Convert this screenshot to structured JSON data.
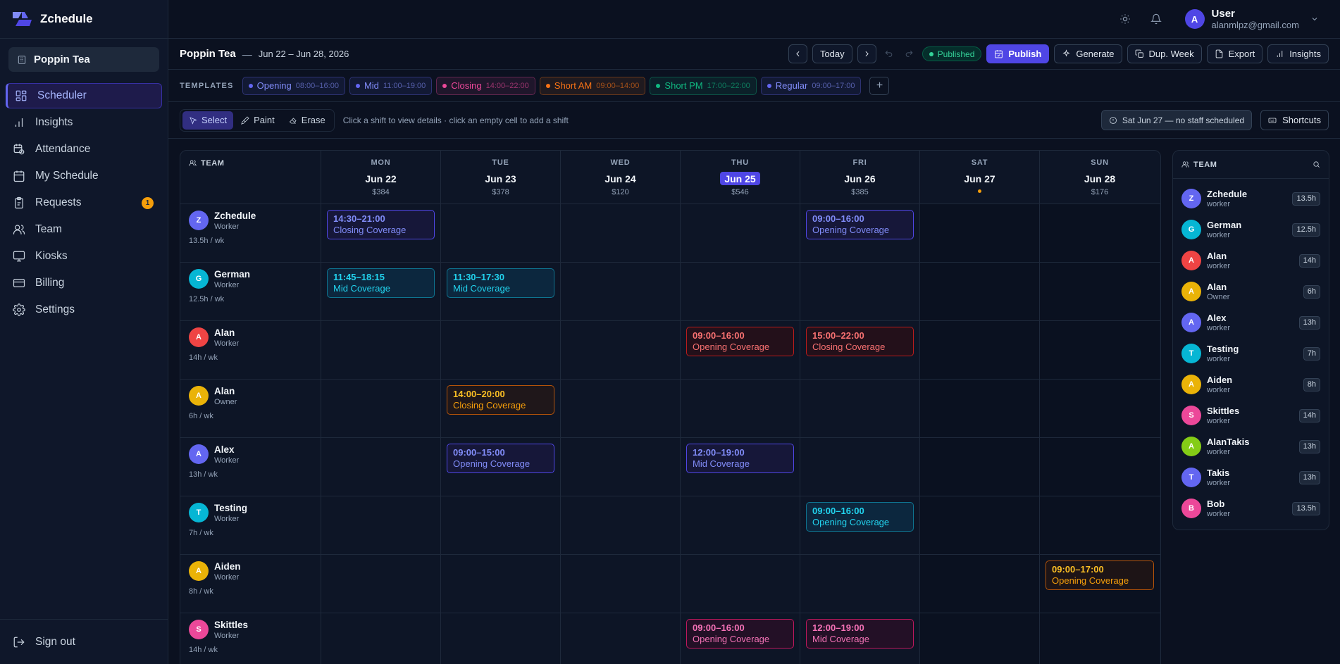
{
  "app": {
    "name": "Zchedule"
  },
  "sidebar": {
    "org": "Poppin Tea",
    "items": [
      {
        "label": "Scheduler",
        "icon": "grid-icon",
        "active": true
      },
      {
        "label": "Insights",
        "icon": "bar-chart-icon"
      },
      {
        "label": "Attendance",
        "icon": "clock-calendar-icon"
      },
      {
        "label": "My Schedule",
        "icon": "calendar-icon"
      },
      {
        "label": "Requests",
        "icon": "clipboard-icon",
        "badge": "1"
      },
      {
        "label": "Team",
        "icon": "users-icon"
      },
      {
        "label": "Kiosks",
        "icon": "monitor-icon"
      },
      {
        "label": "Billing",
        "icon": "credit-card-icon"
      },
      {
        "label": "Settings",
        "icon": "gear-icon"
      }
    ],
    "signout": "Sign out"
  },
  "topbar": {
    "user_initial": "A",
    "user_name": "User",
    "user_email": "alanmlpz@gmail.com"
  },
  "header": {
    "location": "Poppin Tea",
    "dash": "—",
    "range": "Jun 22 – Jun 28, 2026",
    "today": "Today",
    "status": "Published",
    "publish": "Publish",
    "generate": "Generate",
    "dup_week": "Dup. Week",
    "export": "Export",
    "insights": "Insights"
  },
  "templates": {
    "label": "TEMPLATES",
    "items": [
      {
        "name": "Opening",
        "time": "08:00–16:00",
        "color": "#6366f1"
      },
      {
        "name": "Mid",
        "time": "11:00–19:00",
        "color": "#6366f1"
      },
      {
        "name": "Closing",
        "time": "14:00–22:00",
        "color": "#ec4899"
      },
      {
        "name": "Short AM",
        "time": "09:00–14:00",
        "color": "#f97316"
      },
      {
        "name": "Short PM",
        "time": "17:00–22:00",
        "color": "#10b981"
      },
      {
        "name": "Regular",
        "time": "09:00–17:00",
        "color": "#6366f1"
      }
    ],
    "add": "+"
  },
  "tools": {
    "select": "Select",
    "paint": "Paint",
    "erase": "Erase",
    "hint": "Click a shift to view details · click an empty cell to add a shift",
    "warning": "Sat Jun 27 — no staff scheduled",
    "shortcuts": "Shortcuts"
  },
  "grid": {
    "team_label": "TEAM",
    "days": [
      {
        "dow": "MON",
        "date": "Jun 22",
        "cost": "$384"
      },
      {
        "dow": "TUE",
        "date": "Jun 23",
        "cost": "$378"
      },
      {
        "dow": "WED",
        "date": "Jun 24",
        "cost": "$120"
      },
      {
        "dow": "THU",
        "date": "Jun 25",
        "cost": "$546",
        "today": true
      },
      {
        "dow": "FRI",
        "date": "Jun 26",
        "cost": "$385"
      },
      {
        "dow": "SAT",
        "date": "Jun 27",
        "cost": "",
        "warning": true
      },
      {
        "dow": "SUN",
        "date": "Jun 28",
        "cost": "$176"
      }
    ],
    "rows": [
      {
        "name": "Zchedule",
        "role": "Worker",
        "hours": "13.5h / wk",
        "initial": "Z",
        "color": "#6366f1",
        "shifts": [
          {
            "day": 0,
            "time": "14:30–21:00",
            "label": "Closing Coverage",
            "theme": "indigo"
          },
          {
            "day": 4,
            "time": "09:00–16:00",
            "label": "Opening Coverage",
            "theme": "indigo"
          }
        ]
      },
      {
        "name": "German",
        "role": "Worker",
        "hours": "12.5h / wk",
        "initial": "G",
        "color": "#06b6d4",
        "shifts": [
          {
            "day": 0,
            "time": "11:45–18:15",
            "label": "Mid Coverage",
            "theme": "cyan"
          },
          {
            "day": 1,
            "time": "11:30–17:30",
            "label": "Mid Coverage",
            "theme": "cyan"
          }
        ]
      },
      {
        "name": "Alan",
        "role": "Worker",
        "hours": "14h / wk",
        "initial": "A",
        "color": "#ef4444",
        "shifts": [
          {
            "day": 3,
            "time": "09:00–16:00",
            "label": "Opening Coverage",
            "theme": "red"
          },
          {
            "day": 4,
            "time": "15:00–22:00",
            "label": "Closing Coverage",
            "theme": "red"
          }
        ]
      },
      {
        "name": "Alan",
        "role": "Owner",
        "hours": "6h / wk",
        "initial": "A",
        "color": "#eab308",
        "shifts": [
          {
            "day": 1,
            "time": "14:00–20:00",
            "label": "Closing Coverage",
            "theme": "amber"
          }
        ]
      },
      {
        "name": "Alex",
        "role": "Worker",
        "hours": "13h / wk",
        "initial": "A",
        "color": "#6366f1",
        "shifts": [
          {
            "day": 1,
            "time": "09:00–15:00",
            "label": "Opening Coverage",
            "theme": "indigo"
          },
          {
            "day": 3,
            "time": "12:00–19:00",
            "label": "Mid Coverage",
            "theme": "indigo"
          }
        ]
      },
      {
        "name": "Testing",
        "role": "Worker",
        "hours": "7h / wk",
        "initial": "T",
        "color": "#06b6d4",
        "shifts": [
          {
            "day": 4,
            "time": "09:00–16:00",
            "label": "Opening Coverage",
            "theme": "cyan"
          }
        ]
      },
      {
        "name": "Aiden",
        "role": "Worker",
        "hours": "8h / wk",
        "initial": "A",
        "color": "#eab308",
        "shifts": [
          {
            "day": 6,
            "time": "09:00–17:00",
            "label": "Opening Coverage",
            "theme": "amber"
          }
        ]
      },
      {
        "name": "Skittles",
        "role": "Worker",
        "hours": "14h / wk",
        "initial": "S",
        "color": "#ec4899",
        "shifts": [
          {
            "day": 3,
            "time": "09:00–16:00",
            "label": "Opening Coverage",
            "theme": "pink"
          },
          {
            "day": 4,
            "time": "12:00–19:00",
            "label": "Mid Coverage",
            "theme": "pink"
          }
        ]
      }
    ]
  },
  "team_panel": {
    "title": "TEAM",
    "members": [
      {
        "name": "Zchedule",
        "role": "worker",
        "hours": "13.5h",
        "initial": "Z",
        "color": "#6366f1"
      },
      {
        "name": "German",
        "role": "worker",
        "hours": "12.5h",
        "initial": "G",
        "color": "#06b6d4"
      },
      {
        "name": "Alan",
        "role": "worker",
        "hours": "14h",
        "initial": "A",
        "color": "#ef4444"
      },
      {
        "name": "Alan",
        "role": "Owner",
        "hours": "6h",
        "initial": "A",
        "color": "#eab308"
      },
      {
        "name": "Alex",
        "role": "worker",
        "hours": "13h",
        "initial": "A",
        "color": "#6366f1"
      },
      {
        "name": "Testing",
        "role": "worker",
        "hours": "7h",
        "initial": "T",
        "color": "#06b6d4"
      },
      {
        "name": "Aiden",
        "role": "worker",
        "hours": "8h",
        "initial": "A",
        "color": "#eab308"
      },
      {
        "name": "Skittles",
        "role": "worker",
        "hours": "14h",
        "initial": "S",
        "color": "#ec4899"
      },
      {
        "name": "AlanTakis",
        "role": "worker",
        "hours": "13h",
        "initial": "A",
        "color": "#84cc16"
      },
      {
        "name": "Takis",
        "role": "worker",
        "hours": "13h",
        "initial": "T",
        "color": "#6366f1"
      },
      {
        "name": "Bob",
        "role": "worker",
        "hours": "13.5h",
        "initial": "B",
        "color": "#ec4899"
      }
    ]
  }
}
